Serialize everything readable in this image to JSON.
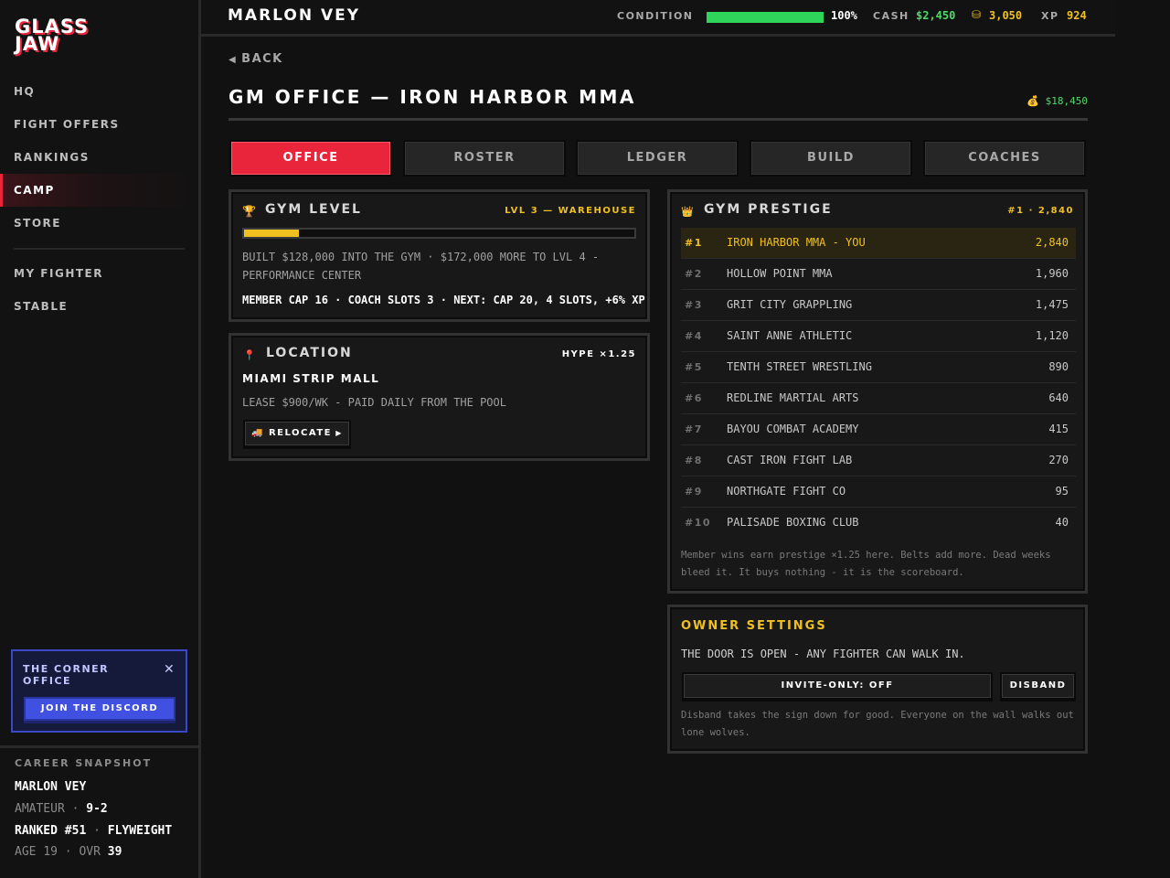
{
  "sidebar": {
    "logo": "GLASS JAW",
    "nav": [
      "HQ",
      "FIGHT OFFERS",
      "RANKINGS",
      "CAMP",
      "STORE"
    ],
    "nav2": [
      "MY FIGHTER",
      "STABLE"
    ],
    "promo": {
      "title": "THE CORNER OFFICE",
      "button": "JOIN THE DISCORD"
    },
    "snapshot": {
      "title": "CAREER SNAPSHOT",
      "name": "MARLON VEY",
      "level": "AMATEUR",
      "record": "9-2",
      "rank": "RANKED #51",
      "division": "FLYWEIGHT",
      "age_label": "AGE",
      "age": "19",
      "ovr_label": "OVR",
      "ovr": "39"
    }
  },
  "topbar": {
    "fighter": "MARLON VEY",
    "condition_label": "CONDITION",
    "condition_value": "100%",
    "condition_pct": 100,
    "cash_label": "CASH",
    "cash": "$2,450",
    "coins": "3,050",
    "xp_label": "XP",
    "xp": "924"
  },
  "page": {
    "back": "BACK",
    "title": "GM OFFICE — IRON HARBOR MMA",
    "bankroll": "$18,450",
    "tabs": [
      "OFFICE",
      "ROSTER",
      "LEDGER",
      "BUILD",
      "COACHES"
    ]
  },
  "gym_level": {
    "title": "GYM LEVEL",
    "tag": "LVL 3 — WAREHOUSE",
    "progress_pct": 14,
    "desc": "BUILT $128,000 INTO THE GYM · $172,000 MORE TO LVL 4 - PERFORMANCE CENTER",
    "perks": "MEMBER CAP 16 · COACH SLOTS 3 · NEXT: CAP 20, 4 SLOTS, +6% XP"
  },
  "location": {
    "title": "LOCATION",
    "tag": "HYPE ×1.25",
    "place": "MIAMI STRIP MALL",
    "lease": "LEASE $900/WK - PAID DAILY FROM THE POOL",
    "button": "RELOCATE"
  },
  "prestige": {
    "title": "GYM PRESTIGE",
    "tag": "#1 · 2,840",
    "rows": [
      {
        "rank": "#1",
        "gym": "IRON HARBOR MMA - YOU",
        "score": "2,840"
      },
      {
        "rank": "#2",
        "gym": "HOLLOW POINT MMA",
        "score": "1,960"
      },
      {
        "rank": "#3",
        "gym": "GRIT CITY GRAPPLING",
        "score": "1,475"
      },
      {
        "rank": "#4",
        "gym": "SAINT ANNE ATHLETIC",
        "score": "1,120"
      },
      {
        "rank": "#5",
        "gym": "TENTH STREET WRESTLING",
        "score": "890"
      },
      {
        "rank": "#6",
        "gym": "REDLINE MARTIAL ARTS",
        "score": "640"
      },
      {
        "rank": "#7",
        "gym": "BAYOU COMBAT ACADEMY",
        "score": "415"
      },
      {
        "rank": "#8",
        "gym": "CAST IRON FIGHT LAB",
        "score": "270"
      },
      {
        "rank": "#9",
        "gym": "NORTHGATE FIGHT CO",
        "score": "95"
      },
      {
        "rank": "#10",
        "gym": "PALISADE BOXING CLUB",
        "score": "40"
      }
    ],
    "note": "Member wins earn prestige ×1.25 here. Belts add more. Dead weeks bleed it. It buys nothing - it is the scoreboard."
  },
  "owner": {
    "title": "OWNER SETTINGS",
    "status": "THE DOOR IS OPEN - ANY FIGHTER CAN WALK IN.",
    "invite_button": "INVITE-ONLY: OFF",
    "disband_button": "DISBAND",
    "note": "Disband takes the sign down for good. Everyone on the wall walks out lone wolves."
  },
  "colors": {
    "accent": "#e8253a",
    "gold": "#f0c020",
    "green": "#4ed96a",
    "discord": "#4050e0"
  },
  "icons": {
    "gym_level": "trophy-icon",
    "location": "pin-icon",
    "prestige": "crown-icon",
    "coins": "coin-stack-icon",
    "bankroll": "money-bag-icon",
    "relocate": "truck-icon"
  }
}
